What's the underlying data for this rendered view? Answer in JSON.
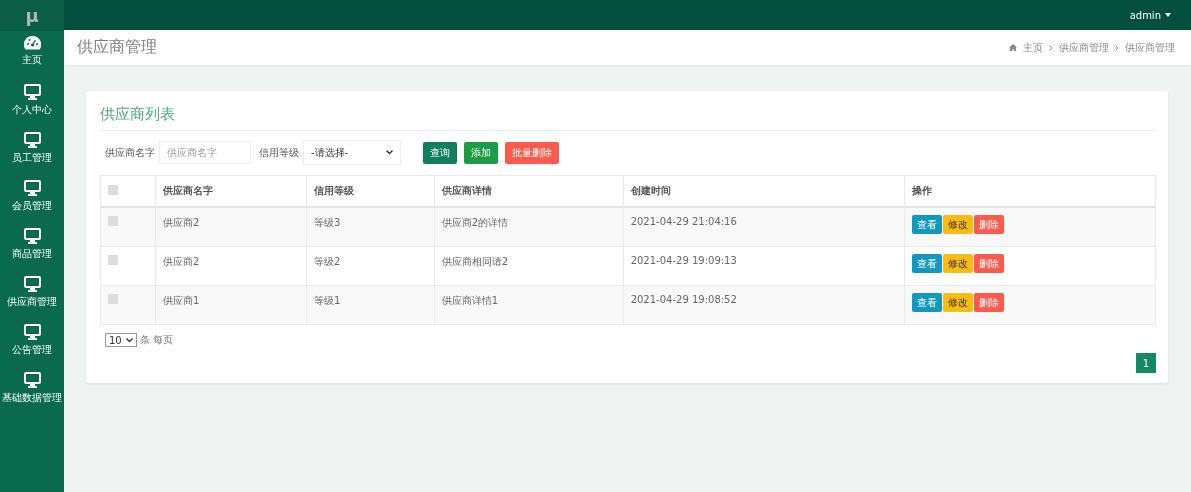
{
  "brand": "μ",
  "user": {
    "name": "admin"
  },
  "sidebar": {
    "items": [
      {
        "label": "主页",
        "kind": "dashboard"
      },
      {
        "label": "个人中心",
        "kind": "monitor"
      },
      {
        "label": "员工管理",
        "kind": "monitor"
      },
      {
        "label": "会员管理",
        "kind": "monitor"
      },
      {
        "label": "商品管理",
        "kind": "monitor"
      },
      {
        "label": "供应商管理",
        "kind": "monitor"
      },
      {
        "label": "公告管理",
        "kind": "monitor"
      },
      {
        "label": "基础数据管理",
        "kind": "monitor"
      }
    ]
  },
  "page_header": {
    "title": "供应商管理",
    "breadcrumbs": [
      "主页",
      "供应商管理",
      "供应商管理"
    ]
  },
  "card": {
    "title": "供应商列表",
    "filters": [
      {
        "kind": "text",
        "label": "供应商名字",
        "placeholder": "供应商名字"
      },
      {
        "kind": "select",
        "label": "信用等级",
        "value": "-请选择-"
      }
    ],
    "buttons": [
      {
        "kind": "search",
        "label": "查询"
      },
      {
        "kind": "add",
        "label": "添加"
      },
      {
        "kind": "delete",
        "label": "批量删除"
      }
    ],
    "table": {
      "select_all": {
        "checked": false
      },
      "columns": [
        "供应商名字",
        "信用等级",
        "供应商详情",
        "创建时间",
        "操作"
      ],
      "rows": [
        {
          "checked": false,
          "cells": [
            "供应商2",
            "等级3",
            "供应商2的详情",
            "2021-04-29 21:04:16"
          ],
          "actions": [
            {
              "kind": "view",
              "label": "查看"
            },
            {
              "kind": "edit",
              "label": "修改"
            },
            {
              "kind": "delete",
              "label": "删除"
            }
          ]
        },
        {
          "checked": false,
          "cells": [
            "供应商2",
            "等级2",
            "供应商相同请2",
            "2021-04-29 19:09:13"
          ],
          "actions": [
            {
              "kind": "view",
              "label": "查看"
            },
            {
              "kind": "edit",
              "label": "修改"
            },
            {
              "kind": "delete",
              "label": "删除"
            }
          ]
        },
        {
          "checked": false,
          "cells": [
            "供应商1",
            "等级1",
            "供应商详情1",
            "2021-04-29 19:08:52"
          ],
          "actions": [
            {
              "kind": "view",
              "label": "查看"
            },
            {
              "kind": "edit",
              "label": "修改"
            },
            {
              "kind": "delete",
              "label": "删除"
            }
          ]
        }
      ]
    },
    "pagination": {
      "page_size": "10",
      "page_size_label": "条 每页",
      "pages": [
        {
          "label": "1",
          "selected": true
        }
      ]
    }
  }
}
